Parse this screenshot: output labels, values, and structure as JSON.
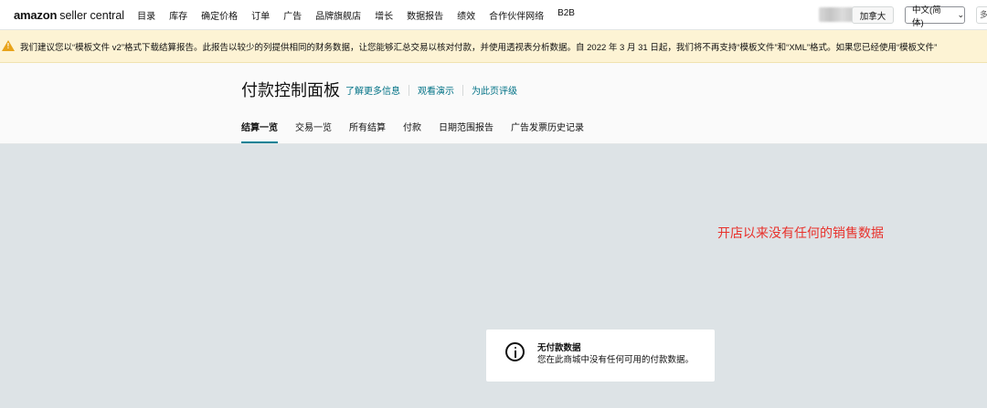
{
  "topnav": {
    "logo_amazon": "amazon",
    "logo_sc": "seller central",
    "items": [
      "目录",
      "库存",
      "确定价格",
      "订单",
      "广告",
      "品牌旗舰店",
      "增长",
      "数据报告",
      "绩效",
      "合作伙伴网络",
      "B2B"
    ],
    "marketplace": "加拿大",
    "language": "中文(简体)",
    "edge_label": "多"
  },
  "banner": {
    "icon": "warning-icon",
    "icon_color": "#e8a319",
    "text": "我们建议您以“模板文件 v2”格式下载结算报告。此报告以较少的列提供相同的财务数据，让您能够汇总交易以核对付款，并使用透视表分析数据。自 2022 年 3 月 31 日起，我们将不再支持“模板文件”和“XML”格式。如果您已经使用“模板文件”"
  },
  "header": {
    "title": "付款控制面板",
    "links": [
      "了解更多信息",
      "观看演示",
      "为此页评级"
    ],
    "tabs": [
      {
        "label": "结算一览",
        "active": true
      },
      {
        "label": "交易一览",
        "active": false
      },
      {
        "label": "所有结算",
        "active": false
      },
      {
        "label": "付款",
        "active": false
      },
      {
        "label": "日期范围报告",
        "active": false
      },
      {
        "label": "广告发票历史记录",
        "active": false
      }
    ]
  },
  "annotation": {
    "text": "开店以来没有任何的销售数据",
    "color": "#e8312b"
  },
  "empty_state": {
    "icon": "info-icon",
    "title": "无付款数据",
    "description": "您在此商城中没有任何可用的付款数据。"
  },
  "colors": {
    "accent": "#008296",
    "link": "#007185",
    "content_bg": "#dde3e6"
  }
}
